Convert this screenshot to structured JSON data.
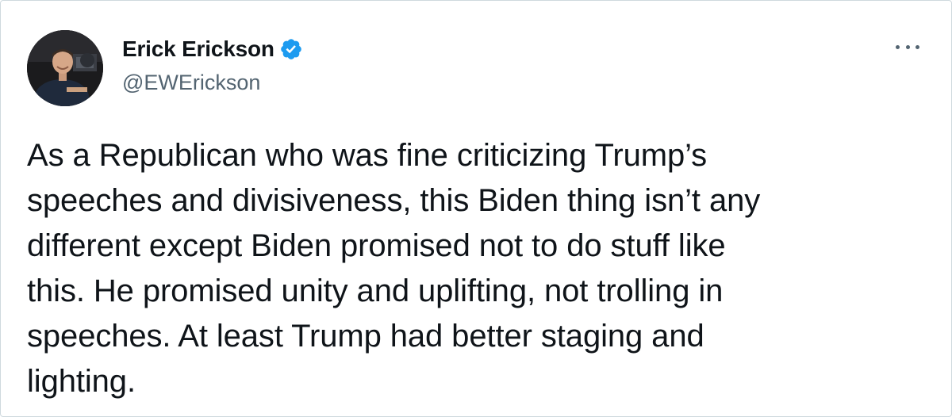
{
  "author": {
    "display_name": "Erick Erickson",
    "handle": "@EWErickson",
    "verified": true,
    "avatar_icon": "profile-photo"
  },
  "tweet": {
    "text": "As a Republican who was fine criticizing Trump’s\nspeeches and divisiveness, this Biden thing isn’t any\ndifferent except Biden promised not to do stuff like\nthis. He promised unity and uplifting, not trolling in\nspeeches. At least Trump had better staging and\nlighting."
  },
  "menu": {
    "icon": "more-horizontal-icon"
  },
  "colors": {
    "text_primary": "#0f1419",
    "text_secondary": "#536471",
    "verified_blue": "#1d9bf0",
    "border": "#cfd9de"
  }
}
